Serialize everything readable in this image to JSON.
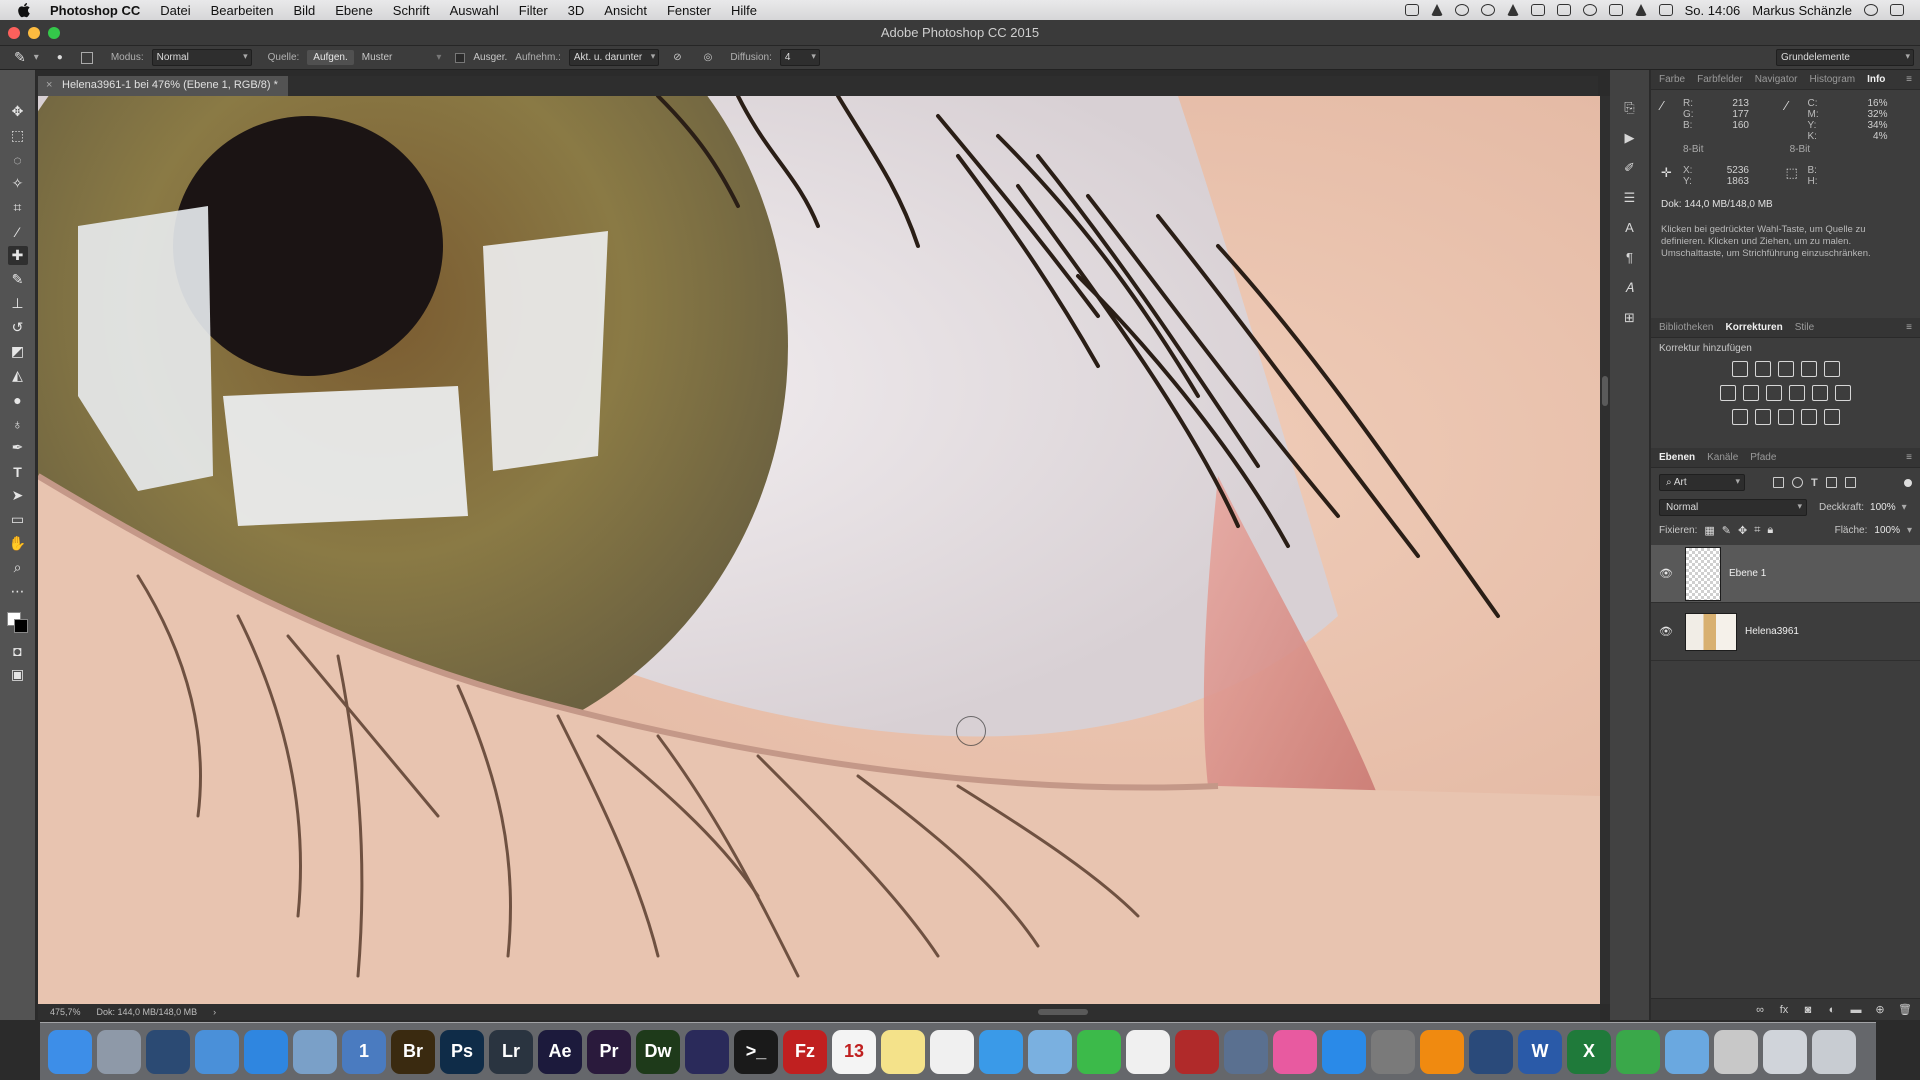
{
  "menubar": {
    "app_name": "Photoshop CC",
    "items": [
      "Datei",
      "Bearbeiten",
      "Bild",
      "Ebene",
      "Schrift",
      "Auswahl",
      "Filter",
      "3D",
      "Ansicht",
      "Fenster",
      "Hilfe"
    ],
    "clock": "So. 14:06",
    "user": "Markus Schänzle"
  },
  "window": {
    "title": "Adobe Photoshop CC 2015"
  },
  "options": {
    "modus_label": "Modus:",
    "modus_value": "Normal",
    "quelle_label": "Quelle:",
    "source_sampled": "Aufgen.",
    "source_pattern": "Muster",
    "aligned_label": "Ausger.",
    "sample_label": "Aufnehm.:",
    "sample_value": "Akt. u. darunter",
    "diffusion_label": "Diffusion:",
    "diffusion_value": "4",
    "workspace": "Grundelemente"
  },
  "document": {
    "tab_title": "Helena3961-1 bei 476% (Ebene 1, RGB/8) *",
    "zoom": "475,7%",
    "doc_size": "Dok: 144,0 MB/148,0 MB"
  },
  "info_panel": {
    "tabs": [
      "Farbe",
      "Farbfelder",
      "Navigator",
      "Histogram",
      "Info"
    ],
    "active_tab": "Info",
    "rgb_keys": [
      "R:",
      "G:",
      "B:"
    ],
    "rgb_vals": [
      "213",
      "177",
      "160"
    ],
    "cmyk_keys": [
      "C:",
      "M:",
      "Y:",
      "K:"
    ],
    "cmyk_vals": [
      "16%",
      "32%",
      "34%",
      "4%"
    ],
    "bit_left": "8-Bit",
    "bit_right": "8-Bit",
    "xy_keys": [
      "X:",
      "Y:"
    ],
    "xy_vals": [
      "5236",
      "1863"
    ],
    "bh_keys": [
      "B:",
      "H:"
    ],
    "doc_size": "Dok: 144,0 MB/148,0 MB",
    "hint": "Klicken bei gedrückter Wahl-Taste, um Quelle zu definieren. Klicken und Ziehen, um zu malen. Umschalttaste, um Strichführung einzuschränken."
  },
  "adjust_panel": {
    "tabs": [
      "Bibliotheken",
      "Korrekturen",
      "Stile"
    ],
    "active_tab": "Korrekturen",
    "subtitle": "Korrektur hinzufügen"
  },
  "layers_panel": {
    "tabs": [
      "Ebenen",
      "Kanäle",
      "Pfade"
    ],
    "active_tab": "Ebenen",
    "filter_kind": "Art",
    "blend_mode": "Normal",
    "opacity_label": "Deckkraft:",
    "opacity_value": "100%",
    "lock_label": "Fixieren:",
    "fill_label": "Fläche:",
    "fill_value": "100%",
    "layers": [
      {
        "name": "Ebene 1",
        "selected": true
      },
      {
        "name": "Helena3961",
        "selected": false
      }
    ]
  },
  "dock": {
    "apps": [
      {
        "name": "Finder",
        "color": "#3d8ee8",
        "label": ""
      },
      {
        "name": "Launchpad",
        "color": "#8e99a8",
        "label": ""
      },
      {
        "name": "Mission Control",
        "color": "#2b4a73",
        "label": ""
      },
      {
        "name": "Folder",
        "color": "#4a90d9",
        "label": ""
      },
      {
        "name": "Safari",
        "color": "#2f86e0",
        "label": ""
      },
      {
        "name": "Preview",
        "color": "#7aa0c8",
        "label": ""
      },
      {
        "name": "1Password",
        "color": "#4a7bc0",
        "label": "1"
      },
      {
        "name": "Bridge",
        "color": "#3a2a10",
        "label": "Br"
      },
      {
        "name": "Photoshop",
        "color": "#0f2c48",
        "label": "Ps"
      },
      {
        "name": "Lightroom",
        "color": "#2a3440",
        "label": "Lr"
      },
      {
        "name": "After Effects",
        "color": "#1c1a3c",
        "label": "Ae"
      },
      {
        "name": "Premiere",
        "color": "#2a1a3c",
        "label": "Pr"
      },
      {
        "name": "Dreamweaver",
        "color": "#1e3a1a",
        "label": "Dw"
      },
      {
        "name": "Illustrator",
        "color": "#2a2a5a",
        "label": ""
      },
      {
        "name": "Terminal",
        "color": "#1a1a1a",
        "label": ">_"
      },
      {
        "name": "FileZilla",
        "color": "#c02020",
        "label": "Fz"
      },
      {
        "name": "Calendar",
        "color": "#f4f4f4",
        "label": "13"
      },
      {
        "name": "Notes",
        "color": "#f4e28a",
        "label": ""
      },
      {
        "name": "Reminders",
        "color": "#f0f0f0",
        "label": ""
      },
      {
        "name": "Messages",
        "color": "#3a9ae8",
        "label": ""
      },
      {
        "name": "Mail",
        "color": "#7ab0e0",
        "label": ""
      },
      {
        "name": "FaceTime",
        "color": "#3cba4a",
        "label": ""
      },
      {
        "name": "Photos",
        "color": "#f0f0f0",
        "label": ""
      },
      {
        "name": "Photo Booth",
        "color": "#b02a2a",
        "label": ""
      },
      {
        "name": "Utility",
        "color": "#5a7090",
        "label": ""
      },
      {
        "name": "iTunes",
        "color": "#e85aa0",
        "label": ""
      },
      {
        "name": "App Store",
        "color": "#2a8ae8",
        "label": ""
      },
      {
        "name": "System Preferences",
        "color": "#7a7a7a",
        "label": ""
      },
      {
        "name": "VLC",
        "color": "#f08a10",
        "label": ""
      },
      {
        "name": "QuickTime",
        "color": "#2a4a7a",
        "label": ""
      },
      {
        "name": "Word",
        "color": "#2a5aa8",
        "label": "W"
      },
      {
        "name": "Excel",
        "color": "#1f7a3a",
        "label": "X"
      },
      {
        "name": "Evernote",
        "color": "#3aa84a",
        "label": ""
      },
      {
        "name": "Applications",
        "color": "#6aa8e0",
        "label": ""
      },
      {
        "name": "Brushes",
        "color": "#c8c8c8",
        "label": ""
      },
      {
        "name": "Documents",
        "color": "#d0d4da",
        "label": ""
      },
      {
        "name": "Trash",
        "color": "#c8ccd2",
        "label": ""
      }
    ]
  }
}
